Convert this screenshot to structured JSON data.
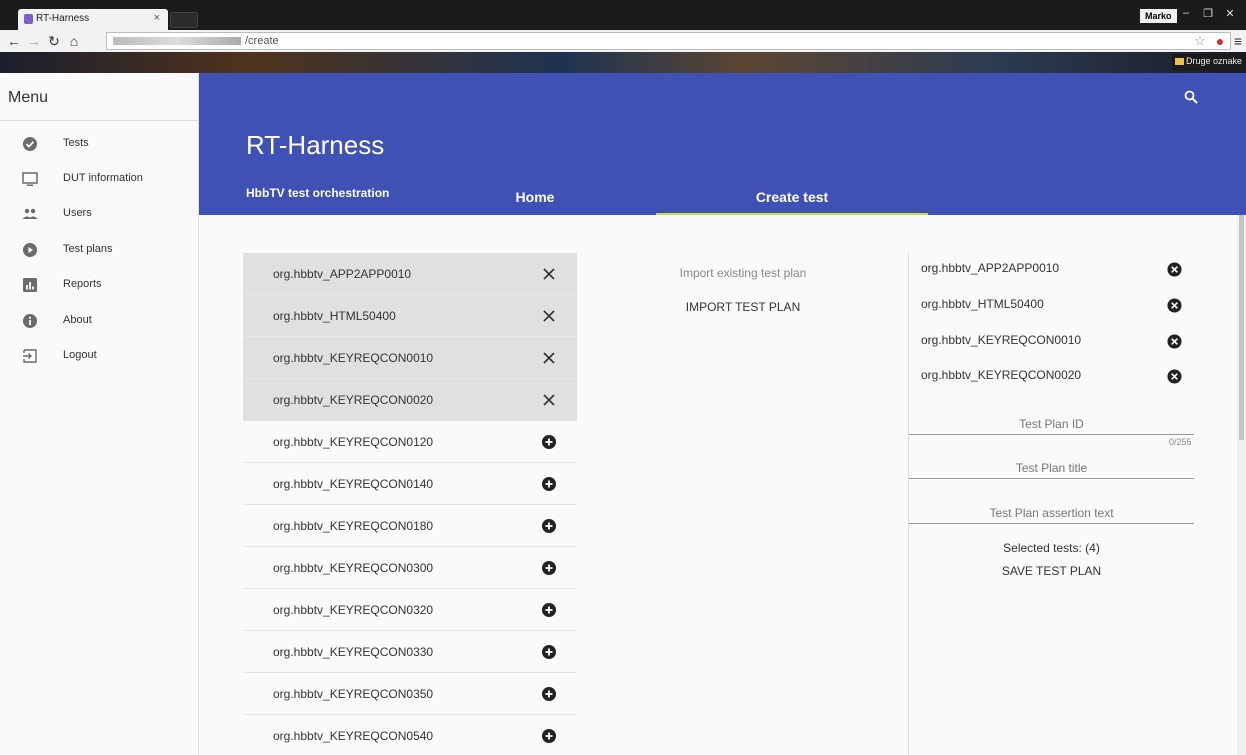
{
  "browser": {
    "tab_title": "RT-Harness",
    "tab_close": "×",
    "url_path": "/create",
    "profile": "Marko",
    "bookmark_folder": "Druge oznake",
    "window_controls": [
      "–",
      "❐",
      "✕"
    ]
  },
  "sidebar": {
    "title": "Menu",
    "items": [
      {
        "label": "Tests",
        "icon": "check-circle-icon"
      },
      {
        "label": "DUT information",
        "icon": "monitor-icon"
      },
      {
        "label": "Users",
        "icon": "group-icon"
      },
      {
        "label": "Test plans",
        "icon": "play-circle-icon"
      },
      {
        "label": "Reports",
        "icon": "bar-chart-icon"
      },
      {
        "label": "About",
        "icon": "info-icon"
      },
      {
        "label": "Logout",
        "icon": "exit-icon"
      }
    ]
  },
  "header": {
    "title": "RT-Harness",
    "subtitle": "HbbTV test orchestration",
    "tabs": [
      {
        "label": "Home",
        "active": false
      },
      {
        "label": "Create test",
        "active": true
      }
    ],
    "accent_color": "#3f51b5",
    "indicator_color": "#cddc39"
  },
  "test_list": {
    "selected": [
      "org.hbbtv_APP2APP0010",
      "org.hbbtv_HTML50400",
      "org.hbbtv_KEYREQCON0010",
      "org.hbbtv_KEYREQCON0020"
    ],
    "available": [
      "org.hbbtv_KEYREQCON0120",
      "org.hbbtv_KEYREQCON0140",
      "org.hbbtv_KEYREQCON0180",
      "org.hbbtv_KEYREQCON0300",
      "org.hbbtv_KEYREQCON0320",
      "org.hbbtv_KEYREQCON0330",
      "org.hbbtv_KEYREQCON0350",
      "org.hbbtv_KEYREQCON0540"
    ]
  },
  "import": {
    "hint": "Import existing test plan",
    "button": "IMPORT TEST PLAN"
  },
  "plan": {
    "selected": [
      "org.hbbtv_APP2APP0010",
      "org.hbbtv_HTML50400",
      "org.hbbtv_KEYREQCON0010",
      "org.hbbtv_KEYREQCON0020"
    ],
    "id_label": "Test Plan ID",
    "id_counter": "0/255",
    "title_label": "Test Plan title",
    "assertion_label": "Test Plan assertion text",
    "selected_count": "Selected tests: (4)",
    "save_button": "SAVE TEST PLAN"
  }
}
